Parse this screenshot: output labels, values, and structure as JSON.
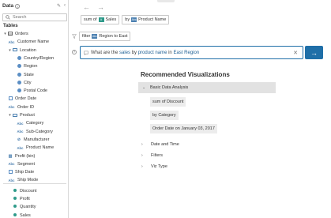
{
  "pane": {
    "title": "Data",
    "search_placeholder": "Search",
    "tables_label": "Tables",
    "table_name": "Orders",
    "fields": [
      {
        "label": "Customer Name",
        "type": "abc",
        "indent": 1
      },
      {
        "label": "Location",
        "type": "folder",
        "indent": 1,
        "expanded": true
      },
      {
        "label": "Country/Region",
        "type": "geo",
        "indent": 2
      },
      {
        "label": "Region",
        "type": "geo",
        "indent": 2
      },
      {
        "label": "State",
        "type": "geo",
        "indent": 2
      },
      {
        "label": "City",
        "type": "geo",
        "indent": 2
      },
      {
        "label": "Postal Code",
        "type": "geo",
        "indent": 2
      },
      {
        "label": "Order Date",
        "type": "date",
        "indent": 1
      },
      {
        "label": "Order ID",
        "type": "abc",
        "indent": 1
      },
      {
        "label": "Product",
        "type": "folder",
        "indent": 1,
        "expanded": true
      },
      {
        "label": "Category",
        "type": "abc",
        "indent": 2
      },
      {
        "label": "Sub-Category",
        "type": "abc",
        "indent": 2
      },
      {
        "label": "Manufacturer",
        "type": "link",
        "indent": 2
      },
      {
        "label": "Product Name",
        "type": "abc",
        "indent": 2
      },
      {
        "label": "Profit (bin)",
        "type": "bin",
        "indent": 1
      },
      {
        "label": "Segment",
        "type": "abc",
        "indent": 1
      },
      {
        "label": "Ship Date",
        "type": "date",
        "indent": 1
      },
      {
        "label": "Ship Mode",
        "type": "abc",
        "indent": 1
      }
    ],
    "measures": [
      {
        "label": "Discount"
      },
      {
        "label": "Profit"
      },
      {
        "label": "Quantity"
      },
      {
        "label": "Sales"
      }
    ]
  },
  "query": {
    "pills": [
      {
        "prefix": "sum of",
        "badge": "#",
        "badge_type": "measure",
        "field": "Sales"
      },
      {
        "prefix": "by",
        "badge": "Abc",
        "badge_type": "dim",
        "field": "Product Name"
      }
    ],
    "filter": {
      "prefix": "filter",
      "badge": "Abc",
      "field": "Region to East"
    },
    "ask_text_before": "What are the ",
    "ask_text_sales": "sales",
    "ask_text_middle": " by ",
    "ask_text_product": "product name",
    "ask_text_after": " in ",
    "ask_text_region": "East Region",
    "go_icon": "arrow-right-icon"
  },
  "recommended": {
    "title": "Recommended Visualizations",
    "basic_header": "Basic Data Analysis",
    "suggestions": [
      "sum of Discount",
      "by Category",
      "Order Date on January 03, 2017"
    ],
    "collapsed": [
      "Date and Time",
      "Filters",
      "Viz Type"
    ]
  }
}
